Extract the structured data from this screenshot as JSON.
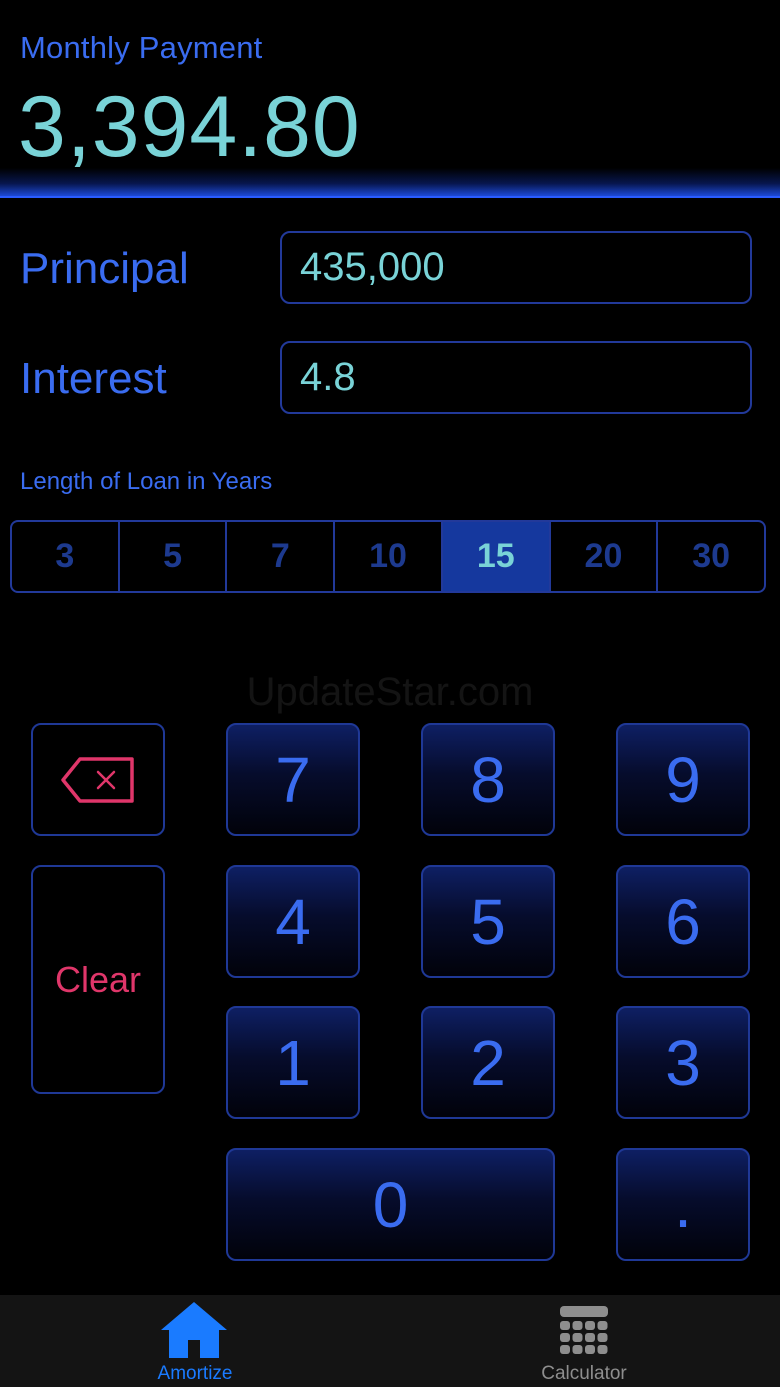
{
  "header": {
    "label": "Monthly Payment",
    "value": "3,394.80"
  },
  "fields": {
    "principal_label": "Principal",
    "principal_value": "435,000",
    "interest_label": "Interest",
    "interest_value": "4.8"
  },
  "loan_length": {
    "label": "Length of Loan in Years",
    "options": [
      "3",
      "5",
      "7",
      "10",
      "15",
      "20",
      "30"
    ],
    "selected": "15"
  },
  "watermark": "UpdateStar.com",
  "keypad": {
    "backspace_icon": "backspace-icon",
    "clear": "Clear",
    "digits": [
      "7",
      "8",
      "9",
      "4",
      "5",
      "6",
      "1",
      "2",
      "3",
      "0",
      "."
    ]
  },
  "tabbar": {
    "tabs": [
      {
        "label": "Amortize",
        "icon": "home-icon",
        "active": true
      },
      {
        "label": "Calculator",
        "icon": "calculator-icon",
        "active": false
      }
    ]
  },
  "colors": {
    "accent_blue": "#3a6cf0",
    "value_teal": "#79d3d7",
    "clear_red": "#e0366a",
    "tab_active": "#1a7bff",
    "tab_inactive": "#8e8e8e"
  }
}
